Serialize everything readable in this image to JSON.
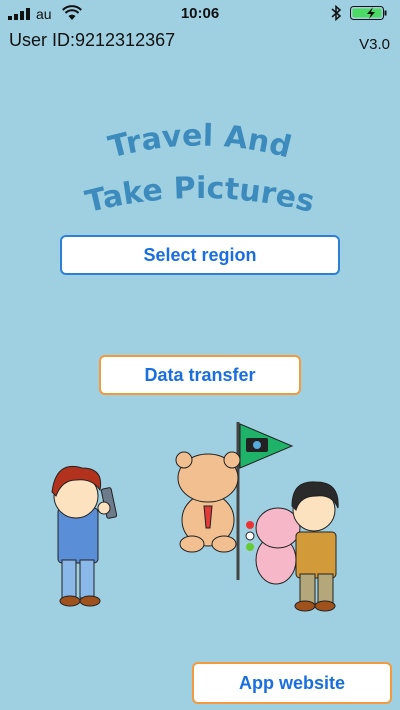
{
  "status_bar": {
    "carrier": "au",
    "time": "10:06"
  },
  "header": {
    "user_id": "User ID:9212312367",
    "version": "V3.0"
  },
  "app_title": {
    "line1": "Travel And",
    "line2": "Take Pictures"
  },
  "buttons": {
    "select_region": "Select region",
    "data_transfer": "Data transfer",
    "app_website": "App website"
  },
  "colors": {
    "background": "#9fd0e2",
    "title": "#3d8bbd",
    "primary_border": "#2e7fd6",
    "secondary_border": "#f29a3c",
    "button_text": "#1a6fe0",
    "battery": "#4cd964"
  },
  "icons": [
    "signal-bars-icon",
    "wifi-icon",
    "bluetooth-icon",
    "battery-icon",
    "camera-flag-icon"
  ]
}
